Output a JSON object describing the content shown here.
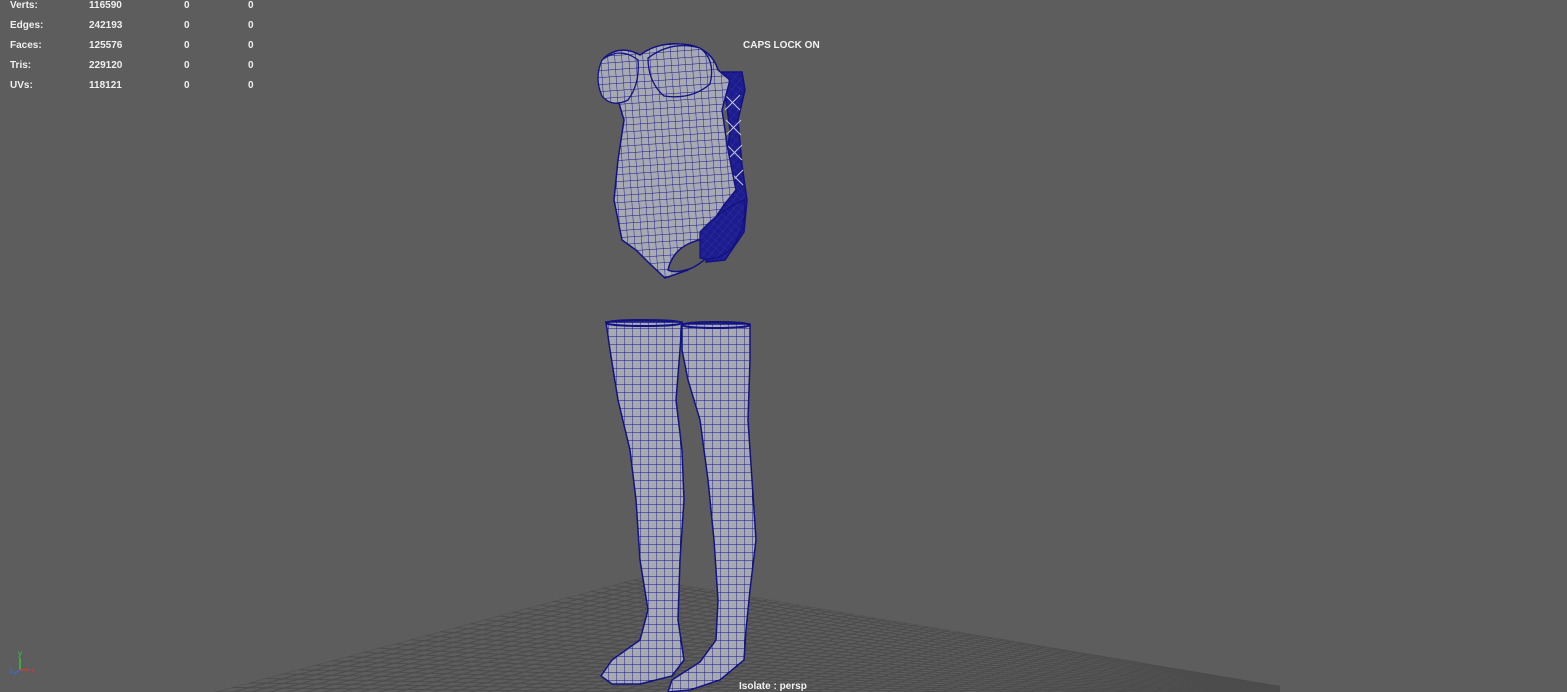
{
  "hud": {
    "rows": [
      {
        "label": "Verts:",
        "total": "116590",
        "selected": "0",
        "component": "0"
      },
      {
        "label": "Edges:",
        "total": "242193",
        "selected": "0",
        "component": "0"
      },
      {
        "label": "Faces:",
        "total": "125576",
        "selected": "0",
        "component": "0"
      },
      {
        "label": "Tris:",
        "total": "229120",
        "selected": "0",
        "component": "0"
      },
      {
        "label": "UVs:",
        "total": "118121",
        "selected": "0",
        "component": "0"
      }
    ]
  },
  "viewport": {
    "caps_lock_text": "CAPS LOCK ON",
    "isolate_text": "Isolate : persp",
    "camera": "persp"
  },
  "axis": {
    "y_label": "y",
    "x_label": "x",
    "z_label": "z",
    "y_color": "#35d035",
    "x_color": "#d43a3a",
    "z_color": "#3a6cd4"
  },
  "colors": {
    "background": "#5d5d5d",
    "mesh_fill": "#a7a9b3",
    "wireframe": "#121283",
    "grid": "#4c4c4c",
    "hud_text": "#f0f0f0"
  }
}
